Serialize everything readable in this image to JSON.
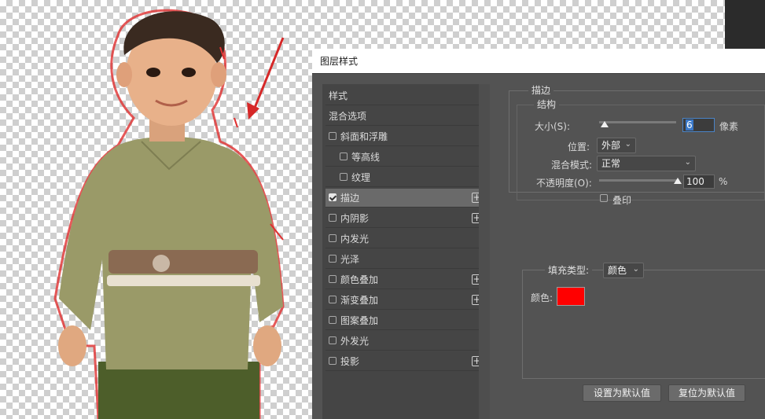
{
  "dialog": {
    "title": "图层样式"
  },
  "style_list": [
    {
      "label": "样式",
      "checkbox": false,
      "plus": false,
      "indent": 0,
      "active": false
    },
    {
      "label": "混合选项",
      "checkbox": false,
      "plus": false,
      "indent": 0,
      "active": false
    },
    {
      "label": "斜面和浮雕",
      "checkbox": true,
      "checked": false,
      "plus": false,
      "indent": 0,
      "active": false
    },
    {
      "label": "等高线",
      "checkbox": true,
      "checked": false,
      "plus": false,
      "indent": 1,
      "active": false
    },
    {
      "label": "纹理",
      "checkbox": true,
      "checked": false,
      "plus": false,
      "indent": 1,
      "active": false
    },
    {
      "label": "描边",
      "checkbox": true,
      "checked": true,
      "plus": true,
      "indent": 0,
      "active": true
    },
    {
      "label": "内阴影",
      "checkbox": true,
      "checked": false,
      "plus": true,
      "indent": 0,
      "active": false
    },
    {
      "label": "内发光",
      "checkbox": true,
      "checked": false,
      "plus": false,
      "indent": 0,
      "active": false
    },
    {
      "label": "光泽",
      "checkbox": true,
      "checked": false,
      "plus": false,
      "indent": 0,
      "active": false
    },
    {
      "label": "颜色叠加",
      "checkbox": true,
      "checked": false,
      "plus": true,
      "indent": 0,
      "active": false
    },
    {
      "label": "渐变叠加",
      "checkbox": true,
      "checked": false,
      "plus": true,
      "indent": 0,
      "active": false
    },
    {
      "label": "图案叠加",
      "checkbox": true,
      "checked": false,
      "plus": false,
      "indent": 0,
      "active": false
    },
    {
      "label": "外发光",
      "checkbox": true,
      "checked": false,
      "plus": false,
      "indent": 0,
      "active": false
    },
    {
      "label": "投影",
      "checkbox": true,
      "checked": false,
      "plus": true,
      "indent": 0,
      "active": false
    }
  ],
  "stroke": {
    "section_title": "描边",
    "structure_title": "结构",
    "size_label": "大小(S):",
    "size_value": "6",
    "size_unit": "像素",
    "position_label": "位置:",
    "position_value": "外部",
    "blend_label": "混合模式:",
    "blend_value": "正常",
    "opacity_label": "不透明度(O):",
    "opacity_value": "100",
    "opacity_unit": "%",
    "opacity_fraction": 1.0,
    "overprint_label": "叠印",
    "fill_type_label": "填充类型:",
    "fill_type_value": "颜色",
    "color_label": "颜色:",
    "color_value": "#ff0000"
  },
  "buttons": {
    "make_default": "设置为默认值",
    "reset_default": "复位为默认值"
  },
  "colors": {
    "stroke_outline": "#e03030",
    "annotation_arrow": "#d62828",
    "dialog_bg": "#535353"
  },
  "icons": [
    "plus-icon",
    "checkbox-icon",
    "chevron-down-icon",
    "slider-thumb-icon",
    "arrow-annotation-icon"
  ]
}
